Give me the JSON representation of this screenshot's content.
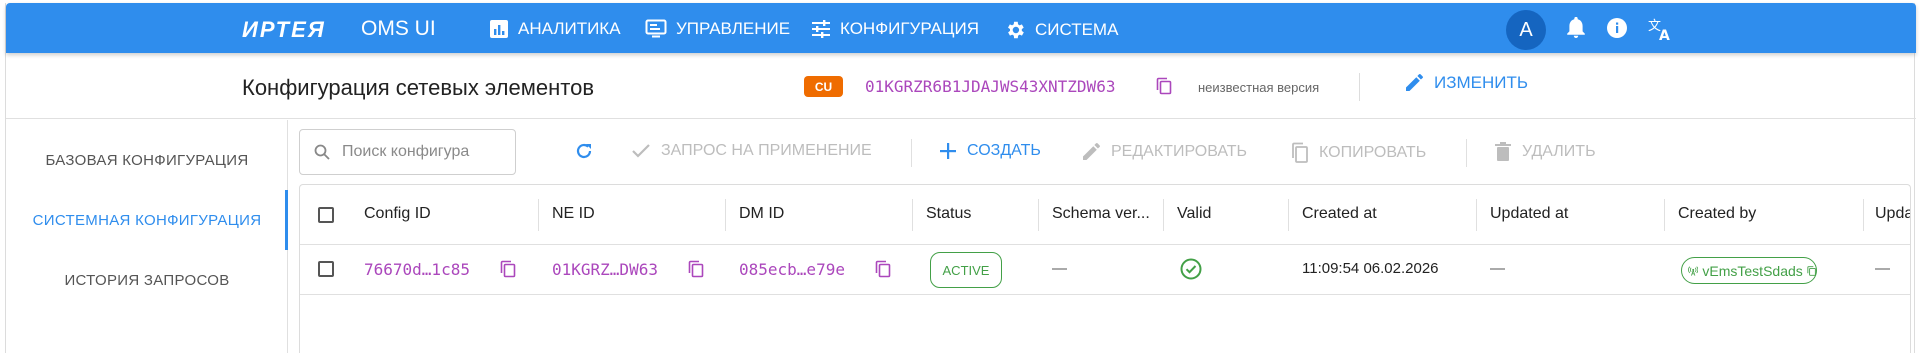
{
  "topbar": {
    "logo": "ИРТЕЯ",
    "app_name": "OMS UI",
    "nav": [
      {
        "label": "АНАЛИТИКА",
        "icon": "bar-chart-icon"
      },
      {
        "label": "УПРАВЛЕНИЕ",
        "icon": "monitor-icon"
      },
      {
        "label": "КОНФИГУРАЦИЯ",
        "icon": "sliders-icon"
      },
      {
        "label": "СИСТЕМА",
        "icon": "gear-icon"
      }
    ],
    "avatar_letter": "A",
    "accent": "#2f8ded"
  },
  "header": {
    "title": "Конфигурация сетевых элементов",
    "badge": "CU",
    "badge_color": "#ef6c00",
    "ne_id": "01KGRZR6B1JDAJWS43XNTZDW63",
    "version": "неизвестная версия",
    "edit_label": "ИЗМЕНИТЬ"
  },
  "sidebar": {
    "items": [
      {
        "label": "БАЗОВАЯ КОНФИГУРАЦИЯ",
        "active": false
      },
      {
        "label": "СИСТЕМНАЯ КОНФИГУРАЦИЯ",
        "active": true
      },
      {
        "label": "ИСТОРИЯ ЗАПРОСОВ",
        "active": false
      }
    ]
  },
  "toolbar": {
    "search_placeholder": "Поиск конфигура",
    "apply_request": "ЗАПРОС НА ПРИМЕНЕНИЕ",
    "create": "СОЗДАТЬ",
    "edit": "РЕДАКТИРОВАТЬ",
    "copy": "КОПИРОВАТЬ",
    "delete": "УДАЛИТЬ"
  },
  "table": {
    "columns": [
      "Config ID",
      "NE ID",
      "DM ID",
      "Status",
      "Schema ver...",
      "Valid",
      "Created at",
      "Updated at",
      "Created by",
      "Upda"
    ],
    "rows": [
      {
        "config_id": "76670d…1c85",
        "ne_id": "01KGRZ…DW63",
        "dm_id": "085ecb…e79e",
        "status": "ACTIVE",
        "schema_version": "—",
        "valid": true,
        "created_at": "11:09:54 06.02.2026",
        "updated_at": "—",
        "created_by": "vEmsTestSdads",
        "updated_by": "—"
      }
    ]
  }
}
